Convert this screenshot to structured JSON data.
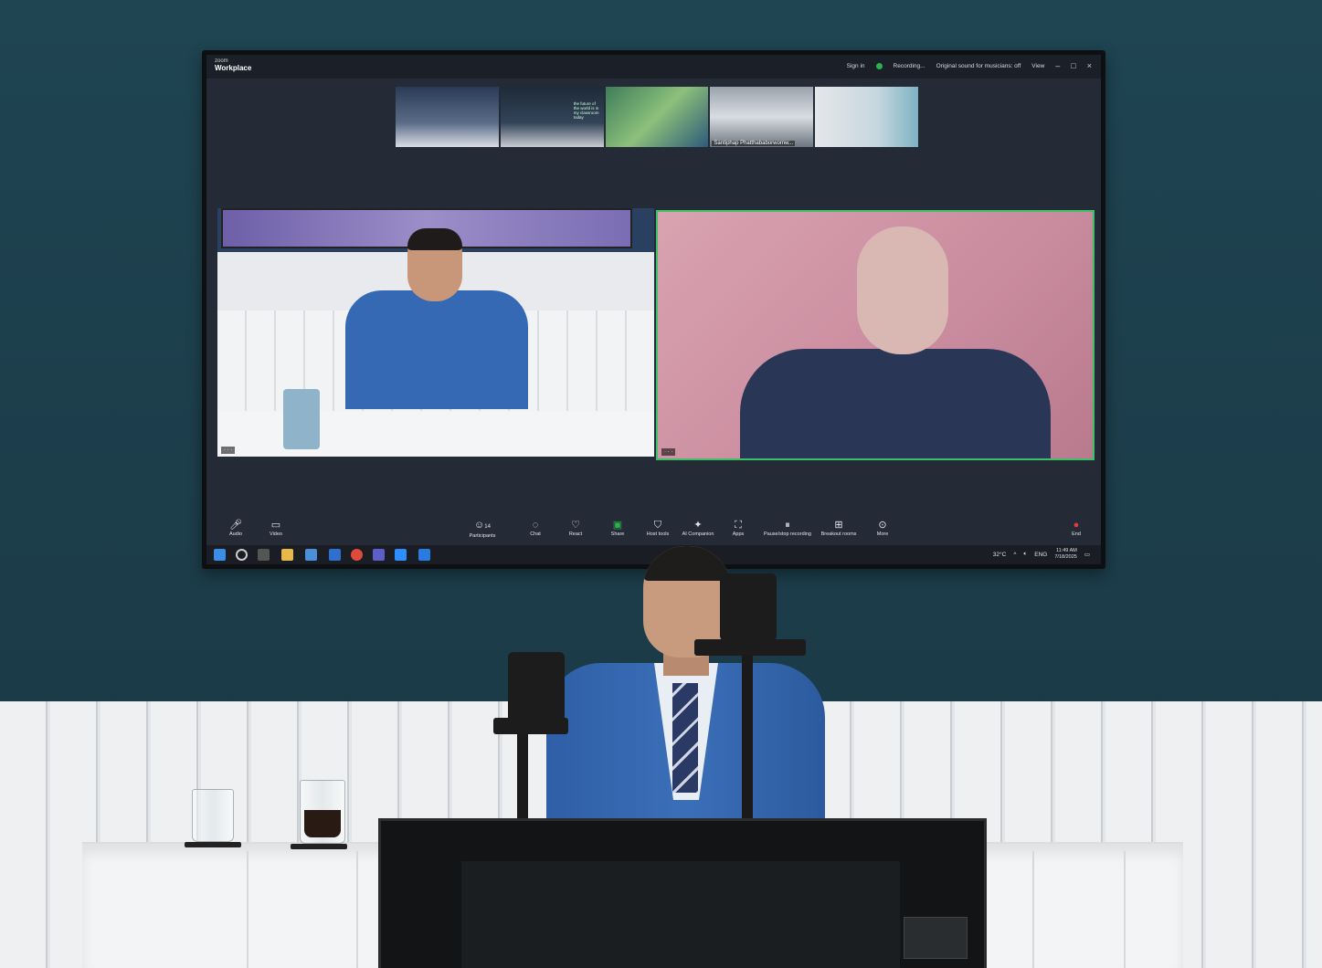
{
  "zoom": {
    "brand_small": "zoom",
    "brand_name": "Workplace",
    "titlebar": {
      "sign_in": "Sign in",
      "recording": "Recording...",
      "original_sound": "Original sound for musicians: off",
      "view": "View"
    },
    "thumbnails": [
      {
        "name": ""
      },
      {
        "name": ""
      },
      {
        "name": "",
        "overlay_text": "the future of the world is in my classroom today"
      },
      {
        "name": "Santiphap Phatthababorwornw..."
      },
      {
        "name": ""
      }
    ],
    "toolbar": {
      "audio": "Audio",
      "video": "Video",
      "participants": "Participants",
      "participants_count": "14",
      "chat": "Chat",
      "react": "React",
      "share": "Share",
      "host_tools": "Host tools",
      "ai_companion": "AI Companion",
      "apps": "Apps",
      "pause_recording": "Pause/stop recording",
      "breakout_rooms": "Breakout rooms",
      "more": "More",
      "end": "End"
    },
    "taskbar": {
      "weather": "32°C",
      "language": "ENG",
      "time": "11:49 AM",
      "date": "7/18/2025"
    }
  },
  "colors": {
    "wall": "#1f4452",
    "suit": "#3a6fb8",
    "active_speaker_border": "#3cc068",
    "end_button": "#e03a3a"
  }
}
